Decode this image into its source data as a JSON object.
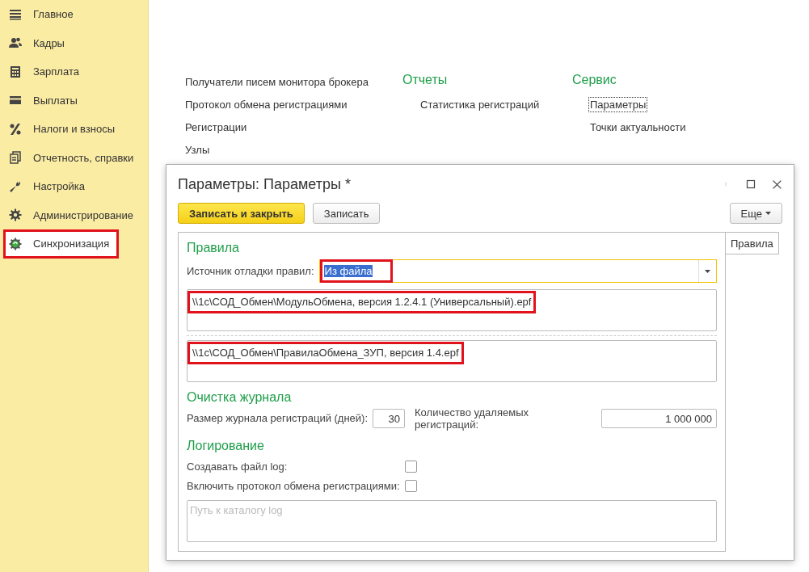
{
  "sidebar": {
    "items": [
      {
        "label": "Главное",
        "selected": false,
        "highlighted": false
      },
      {
        "label": "Кадры",
        "selected": false,
        "highlighted": false
      },
      {
        "label": "Зарплата",
        "selected": false,
        "highlighted": false
      },
      {
        "label": "Выплаты",
        "selected": false,
        "highlighted": false
      },
      {
        "label": "Налоги и взносы",
        "selected": false,
        "highlighted": false
      },
      {
        "label": "Отчетность, справки",
        "selected": false,
        "highlighted": false
      },
      {
        "label": "Настройка",
        "selected": false,
        "highlighted": false
      },
      {
        "label": "Администрирование",
        "selected": false,
        "highlighted": false
      },
      {
        "label": "Синхронизация",
        "selected": true,
        "highlighted": true
      }
    ]
  },
  "sections": [
    {
      "links": [
        {
          "label": "Получатели писем монитора брокера",
          "focused": false
        },
        {
          "label": "Протокол обмена регистрациями",
          "focused": false
        },
        {
          "label": "Регистрации",
          "focused": false
        },
        {
          "label": "Узлы",
          "focused": false
        }
      ]
    },
    {
      "title": "Отчеты",
      "links": [
        {
          "label": "Статистика регистраций",
          "focused": false
        }
      ]
    },
    {
      "title": "Сервис",
      "links": [
        {
          "label": "Параметры",
          "focused": true
        },
        {
          "label": "Точки актуальности",
          "focused": false
        }
      ]
    }
  ],
  "dialog": {
    "title": "Параметры: Параметры *",
    "buttons": [
      {
        "label": "Записать и закрыть",
        "kind": "primary"
      },
      {
        "label": "Записать",
        "kind": "default"
      }
    ],
    "more_button": "Еще",
    "side_tab": "Правила",
    "rules": {
      "title": "Правила",
      "source_label": "Источник отладки правил:",
      "source_value": "Из файла",
      "source_highlighted": true,
      "paths": [
        {
          "value": "\\\\1c\\СОД_Обмен\\МодульОбмена, версия 1.2.4.1 (Универсальный).epf",
          "highlighted": true
        },
        {
          "value": "\\\\1c\\СОД_Обмен\\ПравилаОбмена_ЗУП, версия 1.4.epf",
          "highlighted": true
        }
      ]
    },
    "cleanup": {
      "title": "Очистка журнала",
      "size_label": "Размер журнала регистраций (дней):",
      "size_value": "30",
      "count_label": "Количество удаляемых регистраций:",
      "count_value": "1 000 000"
    },
    "logging": {
      "title": "Логирование",
      "checks": [
        {
          "label": "Создавать файл log:",
          "checked": false
        },
        {
          "label": "Включить протокол обмена регистрациями:",
          "checked": false
        }
      ],
      "path_placeholder": "Путь к каталогу log"
    }
  }
}
